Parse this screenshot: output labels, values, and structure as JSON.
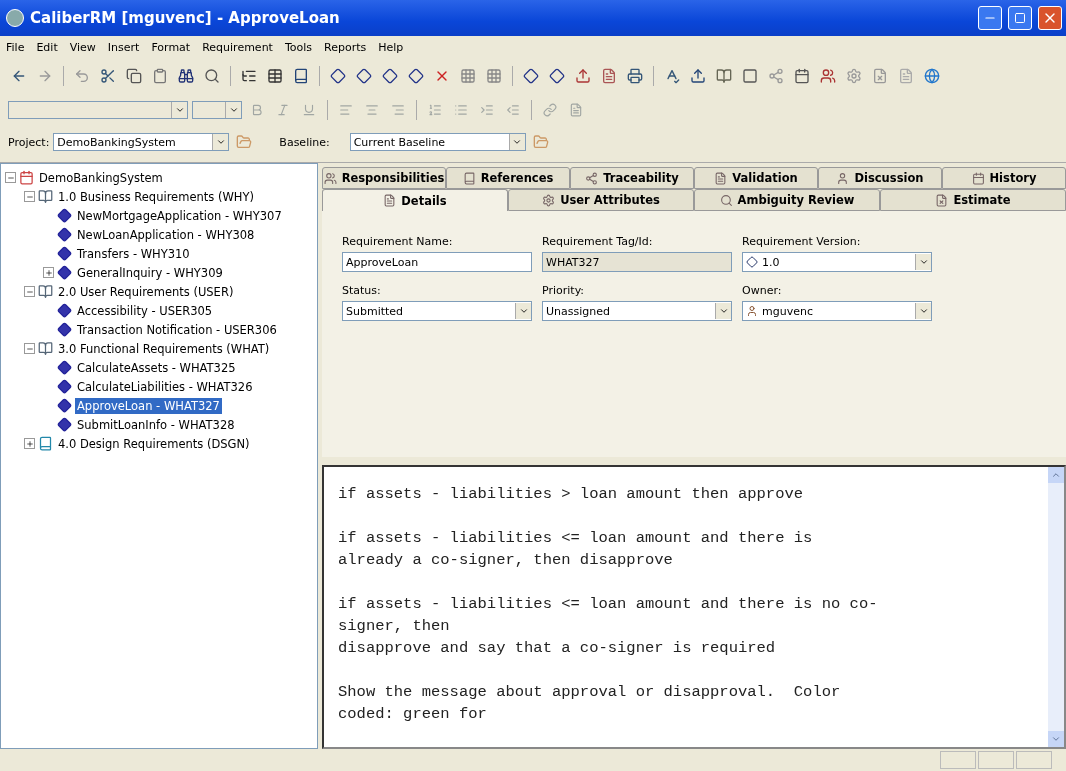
{
  "window": {
    "title": "CaliberRM [mguvenc] - ApproveLoan"
  },
  "menu": [
    "File",
    "Edit",
    "View",
    "Insert",
    "Format",
    "Requirement",
    "Tools",
    "Reports",
    "Help"
  ],
  "project_bar": {
    "project_label": "Project:",
    "project": "DemoBankingSystem",
    "baseline_label": "Baseline:",
    "baseline": "Current Baseline"
  },
  "tree": [
    {
      "label": "DemoBankingSystem",
      "kind": "project",
      "expanded": true,
      "selected": false,
      "children": [
        {
          "label": "1.0 Business Requirements (WHY)",
          "kind": "group",
          "expanded": true,
          "selected": false,
          "children": [
            {
              "label": "NewMortgageApplication - WHY307",
              "kind": "requirement",
              "selected": false
            },
            {
              "label": "NewLoanApplication - WHY308",
              "kind": "requirement",
              "selected": false
            },
            {
              "label": "Transfers - WHY310",
              "kind": "requirement",
              "selected": false
            },
            {
              "label": "GeneralInquiry - WHY309",
              "kind": "requirement",
              "expanded": false,
              "selected": false
            }
          ]
        },
        {
          "label": "2.0 User Requirements (USER)",
          "kind": "group",
          "expanded": true,
          "selected": false,
          "children": [
            {
              "label": "Accessibility - USER305",
              "kind": "requirement",
              "selected": false
            },
            {
              "label": "Transaction Notification - USER306",
              "kind": "requirement",
              "selected": false
            }
          ]
        },
        {
          "label": "3.0 Functional Requirements (WHAT)",
          "kind": "group",
          "expanded": true,
          "selected": false,
          "children": [
            {
              "label": "CalculateAssets - WHAT325",
              "kind": "requirement",
              "selected": false
            },
            {
              "label": "CalculateLiabilities - WHAT326",
              "kind": "requirement",
              "selected": false
            },
            {
              "label": "ApproveLoan - WHAT327",
              "kind": "requirement",
              "selected": true
            },
            {
              "label": "SubmitLoanInfo - WHAT328",
              "kind": "requirement",
              "selected": false
            }
          ]
        },
        {
          "label": "4.0 Design Requirements (DSGN)",
          "kind": "design",
          "expanded": false,
          "selected": false
        }
      ]
    }
  ],
  "tabs_row_1": [
    {
      "label": "Responsibilities",
      "selected": false
    },
    {
      "label": "References",
      "selected": false
    },
    {
      "label": "Traceability",
      "selected": false
    },
    {
      "label": "Validation",
      "selected": false
    },
    {
      "label": "Discussion",
      "selected": false
    },
    {
      "label": "History",
      "selected": false
    }
  ],
  "tabs_row_2": [
    {
      "label": "Details",
      "selected": true
    },
    {
      "label": "User Attributes",
      "selected": false
    },
    {
      "label": "Ambiguity Review",
      "selected": false
    },
    {
      "label": "Estimate",
      "selected": false
    }
  ],
  "fields": [
    {
      "label": "Requirement Name:",
      "value": "ApproveLoan",
      "kind": "text",
      "disabled": false
    },
    {
      "label": "Requirement Tag/Id:",
      "value": "WHAT327",
      "kind": "text",
      "disabled": true
    },
    {
      "label": "Requirement Version:",
      "value": "1.0",
      "kind": "version"
    },
    {
      "label": "Status:",
      "value": "Submitted",
      "kind": "select"
    },
    {
      "label": "Priority:",
      "value": "Unassigned",
      "kind": "select"
    },
    {
      "label": "Owner:",
      "value": "mguvenc",
      "kind": "user"
    }
  ],
  "description": [
    [
      "if assets - liabilities > loan amount then approve"
    ],
    [
      "if assets - liabilities <= loan amount and there is",
      "already a co-signer, then disapprove"
    ],
    [
      "if assets - liabilities <= loan amount and there is no co-",
      "signer, then",
      "disapprove and say that a co-signer is required"
    ],
    [
      "Show the message about approval or disapproval.  Color",
      "coded: green for"
    ]
  ]
}
